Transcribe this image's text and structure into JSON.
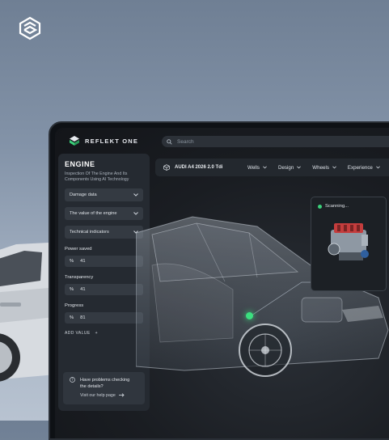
{
  "app": {
    "brand": "REFLEKT ONE"
  },
  "search": {
    "placeholder": "Search"
  },
  "sidebar": {
    "title": "ENGINE",
    "subtitle": "Inspection Of The Engine And Its Components Using AI Technology",
    "dropdowns": [
      {
        "label": "Damage data"
      },
      {
        "label": "The value of the engine"
      },
      {
        "label": "Technical indicators"
      }
    ],
    "fields": [
      {
        "label": "Power saved",
        "unit": "%",
        "value": "41"
      },
      {
        "label": "Transparency",
        "unit": "%",
        "value": "41"
      },
      {
        "label": "Progress",
        "unit": "%",
        "value": "81"
      }
    ],
    "add_value": "ADD VALUE",
    "add_symbol": "+",
    "help": {
      "text": "Have problems checking the details?",
      "link": "Visit our help page"
    }
  },
  "navbar": {
    "model": "AUDI A4 2026 2.0 Tdi",
    "menu": [
      {
        "label": "Wells"
      },
      {
        "label": "Design"
      },
      {
        "label": "Wheels"
      },
      {
        "label": "Experience"
      }
    ]
  },
  "scan": {
    "status": "Scanning..."
  },
  "colors": {
    "accent": "#3bd07a",
    "panel": "#252a31",
    "field": "#343a42"
  },
  "icons": [
    "logo-icon",
    "search-icon",
    "chevron-down-icon",
    "cube-icon",
    "question-icon",
    "arrow-right-icon",
    "plus-icon"
  ]
}
